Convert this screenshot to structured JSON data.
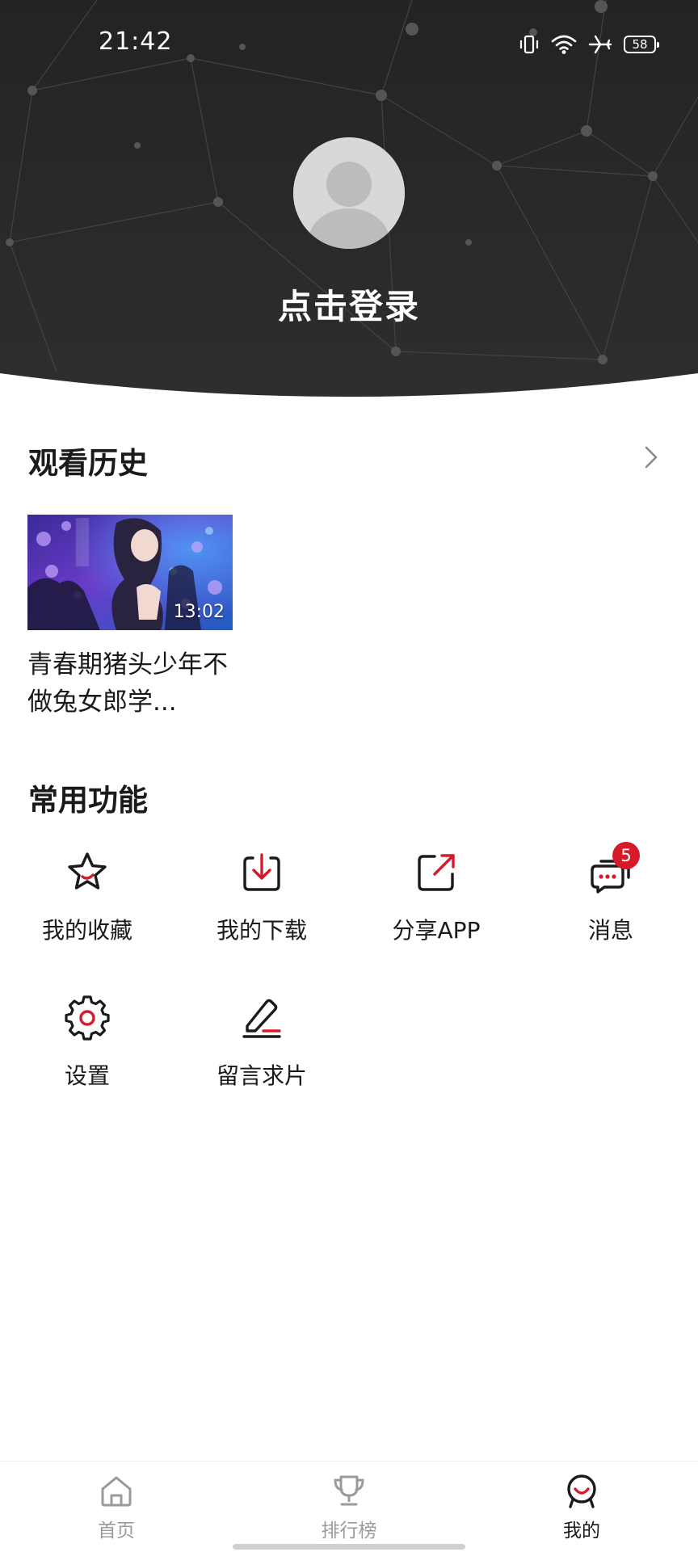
{
  "status_bar": {
    "time": "21:42",
    "battery": "58",
    "icons": [
      "vibrate-icon",
      "wifi-icon",
      "airplane-icon",
      "battery-icon"
    ]
  },
  "header": {
    "login_text": "点击登录",
    "avatar_icon": "user-placeholder-icon"
  },
  "history": {
    "title": "观看历史",
    "more_icon": "chevron-right-icon",
    "items": [
      {
        "title": "青春期猪头少年不做兔女郎学...",
        "duration": "13:02"
      }
    ]
  },
  "functions": {
    "title": "常用功能",
    "items": [
      {
        "label": "我的收藏",
        "icon": "star-icon"
      },
      {
        "label": "我的下载",
        "icon": "download-icon"
      },
      {
        "label": "分享APP",
        "icon": "share-icon"
      },
      {
        "label": "消息",
        "icon": "message-icon",
        "badge": "5"
      },
      {
        "label": "设置",
        "icon": "gear-icon"
      },
      {
        "label": "留言求片",
        "icon": "edit-icon"
      }
    ]
  },
  "bottom_nav": {
    "items": [
      {
        "label": "首页",
        "icon": "home-icon",
        "active": false
      },
      {
        "label": "排行榜",
        "icon": "trophy-icon",
        "active": false
      },
      {
        "label": "我的",
        "icon": "profile-icon",
        "active": true
      }
    ]
  },
  "colors": {
    "accent": "#d71a2a",
    "header_bg": "#2a2a2a",
    "text": "#1a1a1a",
    "muted": "#9a9a9a"
  }
}
